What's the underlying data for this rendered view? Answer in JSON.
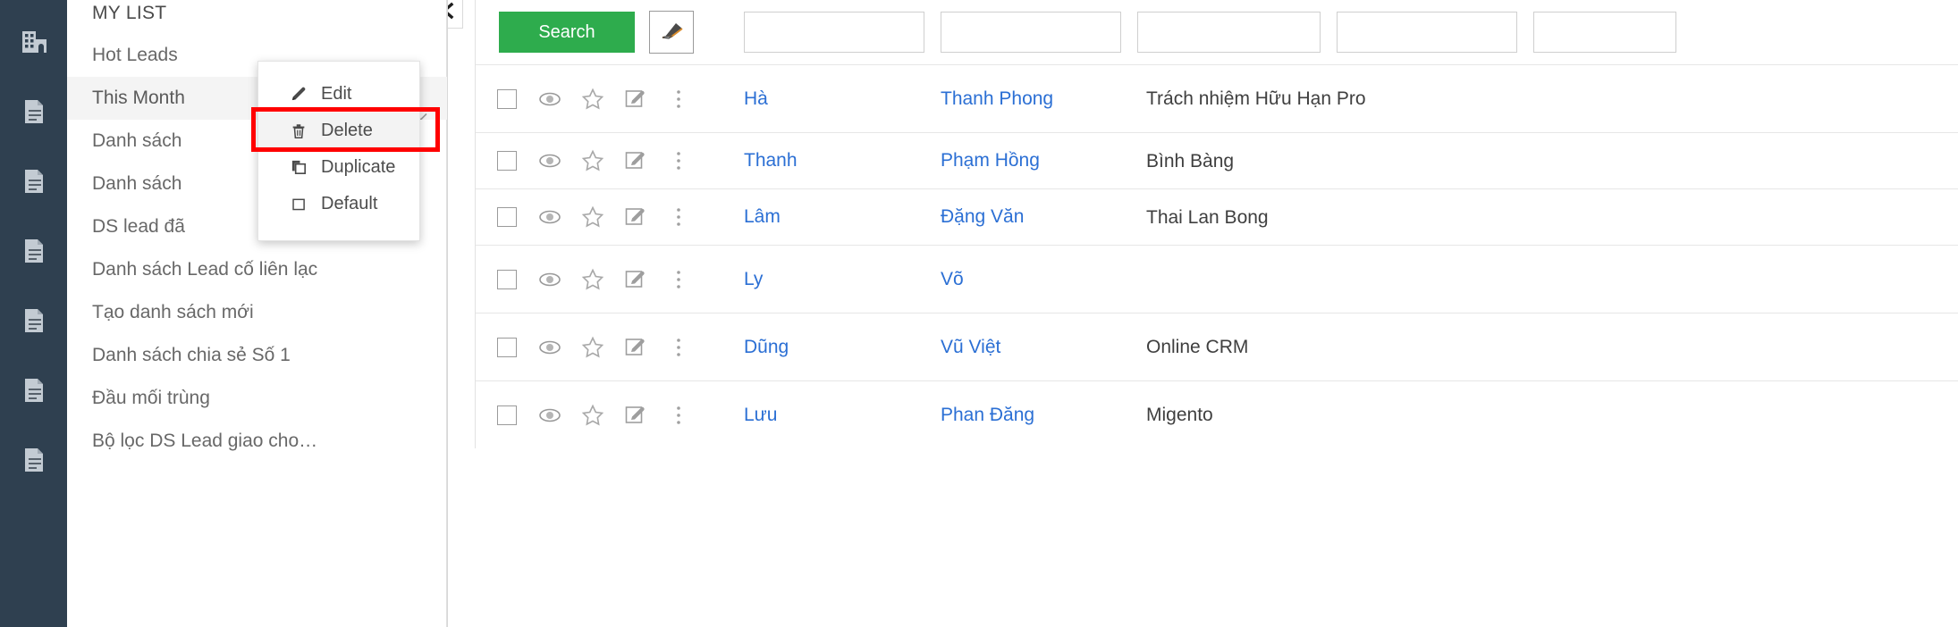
{
  "rail": {
    "items": [
      {
        "name": "company-icon",
        "icon": "building-icon"
      },
      {
        "name": "document-icon-1",
        "icon": "document-icon"
      },
      {
        "name": "document-icon-2",
        "icon": "document-icon"
      },
      {
        "name": "document-icon-3",
        "icon": "document-icon"
      },
      {
        "name": "document-icon-4",
        "icon": "document-icon"
      },
      {
        "name": "document-icon-5",
        "icon": "document-icon"
      },
      {
        "name": "document-icon-6",
        "icon": "document-icon"
      }
    ]
  },
  "sidebar": {
    "title": "MY LIST",
    "items": [
      {
        "label": "Hot Leads",
        "active": false,
        "chevron": false
      },
      {
        "label": "This Month",
        "active": true,
        "chevron": true
      },
      {
        "label": "Danh sách",
        "active": false,
        "chevron": false
      },
      {
        "label": "Danh sách",
        "active": false,
        "chevron": false
      },
      {
        "label": "DS lead đã",
        "active": false,
        "chevron": false
      },
      {
        "label": "Danh sách Lead cố liên lạc",
        "active": false,
        "chevron": false
      },
      {
        "label": "Tạo danh sách mới",
        "active": false,
        "chevron": false
      },
      {
        "label": "Danh sách chia sẻ Số 1",
        "active": false,
        "chevron": false
      },
      {
        "label": "Đầu mối trùng",
        "active": false,
        "chevron": false
      },
      {
        "label": "Bộ lọc DS Lead giao cho…",
        "active": false,
        "chevron": false
      }
    ]
  },
  "context_menu": {
    "items": [
      {
        "label": "Edit",
        "icon": "pencil-icon",
        "highlighted": false
      },
      {
        "label": "Delete",
        "icon": "trash-icon",
        "highlighted": true
      },
      {
        "label": "Duplicate",
        "icon": "copy-icon",
        "highlighted": false
      },
      {
        "label": "Default",
        "icon": "square-icon",
        "highlighted": false
      }
    ],
    "highlight_color": "#ff0000"
  },
  "toolbar": {
    "search_label": "Search",
    "search_color": "#2eac4d",
    "erase_icon": "eraser-icon",
    "collapse_icon": "chevron-left-icon",
    "filters": [
      {
        "name": "filter-input-1",
        "value": "",
        "placeholder": ""
      },
      {
        "name": "filter-input-2",
        "value": "",
        "placeholder": ""
      },
      {
        "name": "filter-input-3",
        "value": "",
        "placeholder": ""
      },
      {
        "name": "filter-input-4",
        "value": "",
        "placeholder": ""
      },
      {
        "name": "filter-input-5",
        "value": "",
        "placeholder": ""
      }
    ]
  },
  "table": {
    "row_icons": [
      "checkbox",
      "eye-icon",
      "star-icon",
      "edit-note-icon",
      "more-vertical-icon"
    ],
    "rows": [
      {
        "first_name": "Hà",
        "last_name": "Thanh Phong",
        "organization": "Trách nhiệm Hữu Hạn Pro",
        "tall": true
      },
      {
        "first_name": "Thanh",
        "last_name": "Phạm Hồng",
        "organization": "Bình Bàng",
        "tall": false
      },
      {
        "first_name": "Lâm",
        "last_name": "Đặng Văn",
        "organization": "Thai Lan Bong",
        "tall": false
      },
      {
        "first_name": "Ly",
        "last_name": "Võ",
        "organization": "",
        "tall": false
      },
      {
        "first_name": "Dũng",
        "last_name": "Vũ Việt",
        "organization": "Online CRM",
        "tall": false
      },
      {
        "first_name": "Lưu",
        "last_name": "Phan Đăng",
        "organization": "Migento",
        "tall": false
      }
    ]
  }
}
